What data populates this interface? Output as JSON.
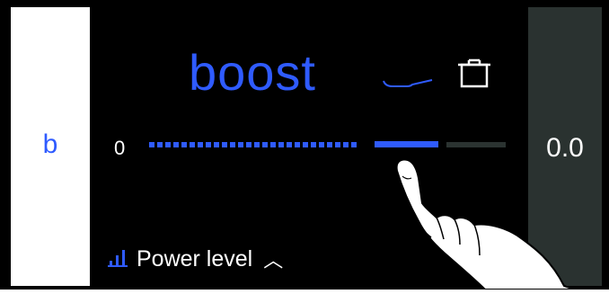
{
  "left_panel": {
    "letter": "b"
  },
  "right_panel": {
    "value": "0.0"
  },
  "main": {
    "title": "boost",
    "slider": {
      "min_label": "0"
    },
    "footer": {
      "label": "Power level",
      "caret": "︿"
    }
  },
  "colors": {
    "accent": "#2f5bff",
    "background": "#000000",
    "right_panel": "#2a3230"
  },
  "icons": [
    "pan-icon",
    "pot-icon",
    "bars-icon",
    "chevron-up-icon",
    "finger-pointer-icon"
  ]
}
